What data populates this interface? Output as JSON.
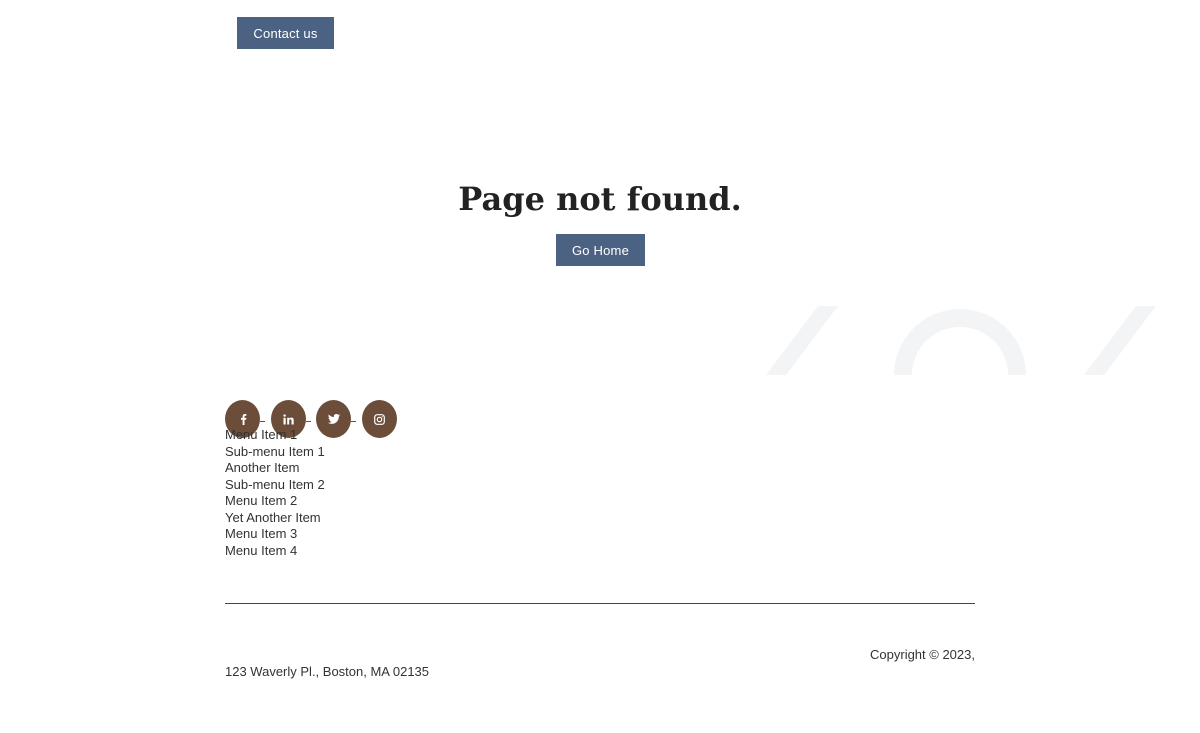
{
  "header": {
    "contact_label": "Contact us"
  },
  "main": {
    "title": "Page not found.",
    "home_label": "Go Home"
  },
  "social": {
    "items": [
      {
        "icon": "facebook-icon"
      },
      {
        "icon": "linkedin-icon"
      },
      {
        "icon": "twitter-icon"
      },
      {
        "icon": "instagram-icon"
      }
    ],
    "color": "#6b4d3a"
  },
  "footer": {
    "menu": [
      "Menu Item 1",
      "Sub-menu Item 1",
      "Another Item",
      "Sub-menu Item 2",
      "Menu Item 2",
      "Yet Another Item",
      "Menu Item 3",
      "Menu Item 4"
    ],
    "copyright": "Copyright © 2023,",
    "address": "123 Waverly Pl., Boston, MA 02135"
  },
  "colors": {
    "button": "#4b6282",
    "decor": "#f2f4f6"
  }
}
